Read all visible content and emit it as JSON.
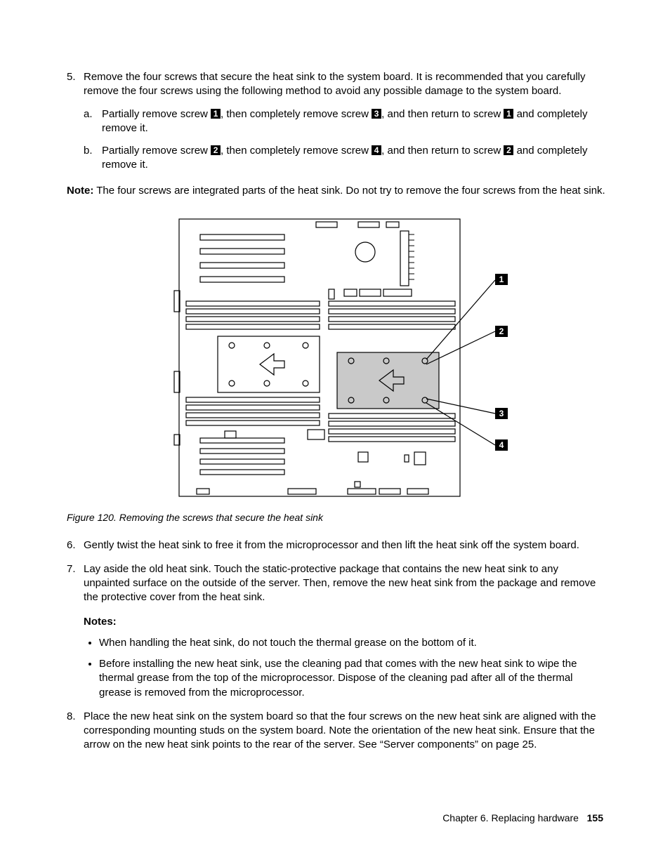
{
  "steps": {
    "s5": {
      "num": "5.",
      "text": "Remove the four screws that secure the heat sink to the system board. It is recommended that you carefully remove the four screws using the following method to avoid any possible damage to the system board.",
      "a": {
        "num": "a.",
        "seg1": "Partially remove screw ",
        "c1": "1",
        "seg2": ", then completely remove screw ",
        "c2": "3",
        "seg3": ", and then return to screw ",
        "c3": "1",
        "seg4": " and completely remove it."
      },
      "b": {
        "num": "b.",
        "seg1": "Partially remove screw ",
        "c1": "2",
        "seg2": ", then completely remove screw ",
        "c2": "4",
        "seg3": ", and then return to screw ",
        "c3": "2",
        "seg4": " and completely remove it."
      }
    },
    "note_label": "Note:",
    "note_text": " The four screws are integrated parts of the heat sink. Do not try to remove the four screws from the heat sink.",
    "s6": {
      "num": "6.",
      "text": "Gently twist the heat sink to free it from the microprocessor and then lift the heat sink off the system board."
    },
    "s7": {
      "num": "7.",
      "text": "Lay aside the old heat sink. Touch the static-protective package that contains the new heat sink to any unpainted surface on the outside of the server. Then, remove the new heat sink from the package and remove the protective cover from the heat sink.",
      "notes_heading": "Notes:",
      "bullet1": "When handling the heat sink, do not touch the thermal grease on the bottom of it.",
      "bullet2": "Before installing the new heat sink, use the cleaning pad that comes with the new heat sink to wipe the thermal grease from the top of the microprocessor. Dispose of the cleaning pad after all of the thermal grease is removed from the microprocessor."
    },
    "s8": {
      "num": "8.",
      "text": "Place the new heat sink on the system board so that the four screws on the new heat sink are aligned with the corresponding mounting studs on the system board. Note the orientation of the new heat sink. Ensure that the arrow on the new heat sink points to the rear of the server. See “Server components” on page 25."
    }
  },
  "figure": {
    "caption": "Figure 120. Removing the screws that secure the heat sink",
    "callouts": {
      "c1": "1",
      "c2": "2",
      "c3": "3",
      "c4": "4"
    }
  },
  "footer": {
    "chapter": "Chapter 6. Replacing hardware",
    "page": "155"
  }
}
